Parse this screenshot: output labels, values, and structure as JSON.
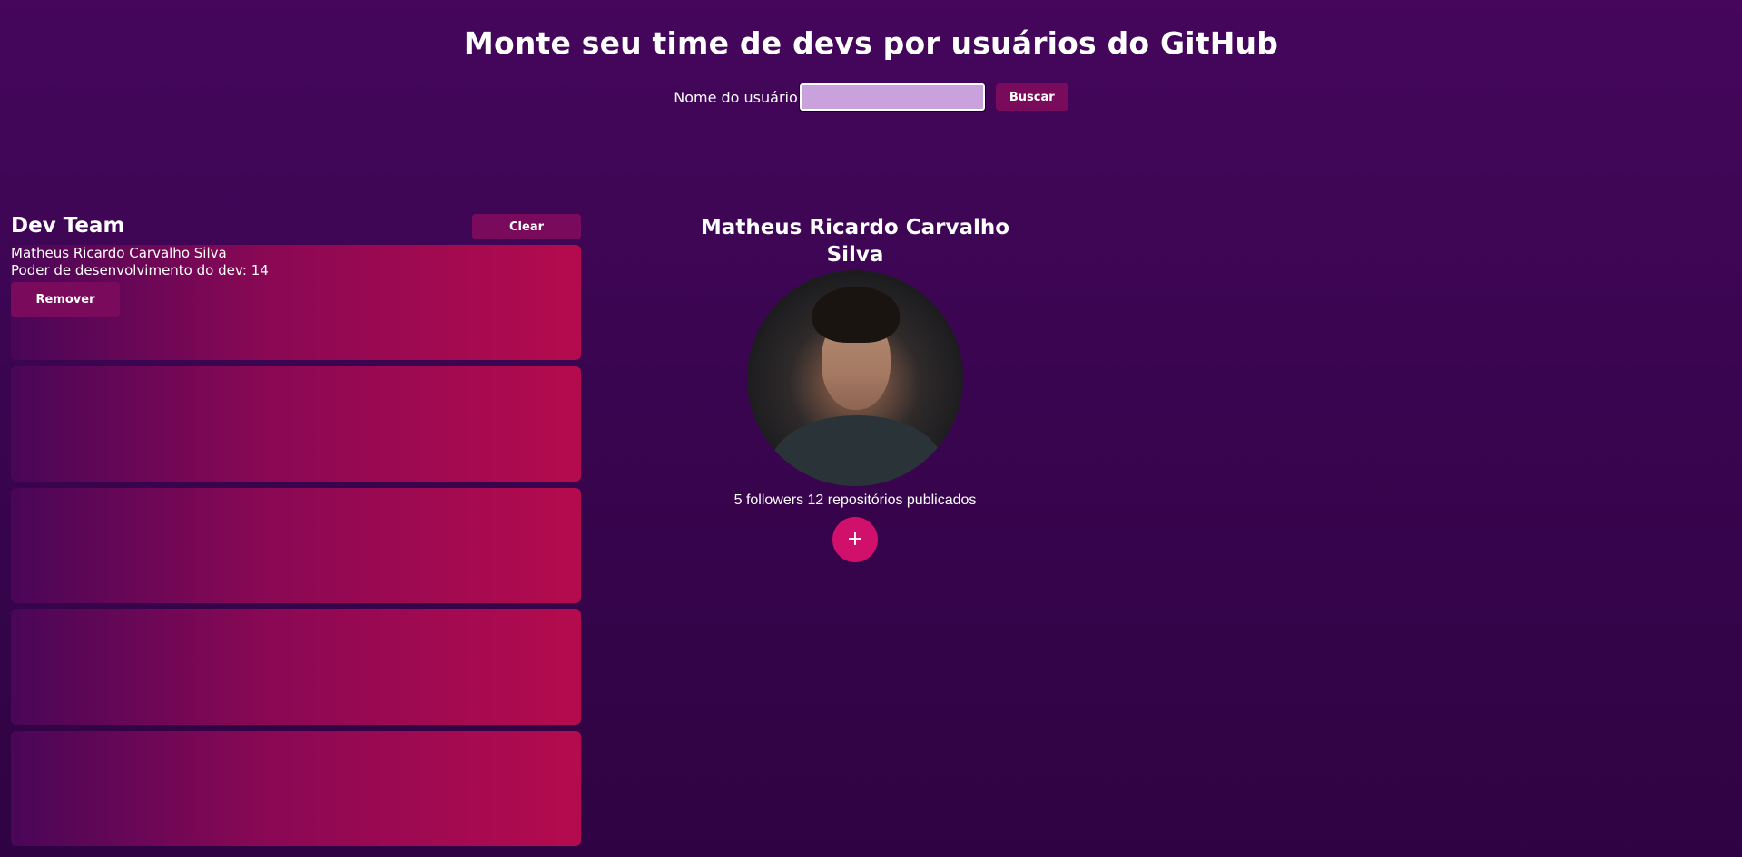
{
  "header": {
    "title": "Monte seu time de devs por usuários do GitHub"
  },
  "search": {
    "label": "Nome do usuário",
    "value": "",
    "placeholder": "",
    "button_label": "Buscar"
  },
  "team": {
    "title": "Dev Team",
    "clear_label": "Clear",
    "slots": [
      {
        "name": "Matheus Ricardo Carvalho Silva",
        "power_text": "Poder de desenvolvimento do dev: 14",
        "remove_label": "Remover"
      },
      {
        "name": "",
        "power_text": "",
        "remove_label": ""
      },
      {
        "name": "",
        "power_text": "",
        "remove_label": ""
      },
      {
        "name": "",
        "power_text": "",
        "remove_label": ""
      },
      {
        "name": "",
        "power_text": "",
        "remove_label": ""
      }
    ]
  },
  "profile": {
    "name": "Matheus Ricardo Carvalho Silva",
    "stats": "5 followers 12 repositórios publicados",
    "add_label": "+"
  },
  "colors": {
    "background_top": "#45065c",
    "background_bottom": "#2f0343",
    "button": "#7a0a5c",
    "slot_gradient_start": "#4a0658",
    "slot_gradient_end": "#b50b4e",
    "input_fill": "#c9a2dd",
    "add_button": "#d1106c"
  },
  "icons": {
    "avatar": "user-photo"
  }
}
